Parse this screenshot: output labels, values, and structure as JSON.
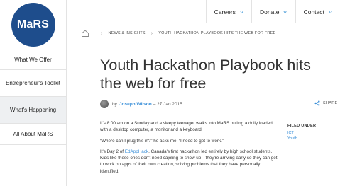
{
  "logo": {
    "text": "MaRS",
    "color": "#1e4d8c"
  },
  "sidebar": {
    "items": [
      {
        "label": "What We Offer"
      },
      {
        "label": "Entrepreneur's Toolkit"
      },
      {
        "label": "What's Happening",
        "active": true
      },
      {
        "label": "All About MaRS"
      }
    ]
  },
  "topnav": {
    "items": [
      {
        "label": "Careers",
        "icon": "chevron-down-icon"
      },
      {
        "label": "Donate",
        "icon": "chevron-down-icon"
      },
      {
        "label": "Contact",
        "icon": "chevron-down-icon"
      }
    ]
  },
  "breadcrumb": {
    "home_icon": "home-icon",
    "items": [
      "NEWS & INSIGHTS",
      "YOUTH HACKATHON PLAYBOOK HITS THE WEB FOR FREE"
    ]
  },
  "article": {
    "title": "Youth Hackathon Playbook hits the web for free",
    "byline_prefix": "by",
    "author": "Joseph Wilson",
    "date": "– 27 Jan 2015",
    "share_label": "SHARE",
    "p1": "It's 8:00 am on a Sunday and a sleepy teenager walks into MaRS pulling a dolly loaded with a desktop computer, a monitor and a keyboard.",
    "p2": "“Where can I plug this in?” he asks me. “I need to get to work.”",
    "p3_before": "It's Day 2 of ",
    "p3_link": "EdAppHack",
    "p3_after": ", Canada's first hackathon led entirely by high school students. Kids like these ones don't need cajoling to show up—they're arriving early so they can get to work on apps of their own creation, solving problems that they have personally identified."
  },
  "filed_under": {
    "label": "FILED UNDER",
    "tags": [
      "ICT",
      "Youth"
    ]
  },
  "colors": {
    "link": "#3a8fd8",
    "accent": "#6aaee0",
    "active_bg": "#eef0f2"
  }
}
